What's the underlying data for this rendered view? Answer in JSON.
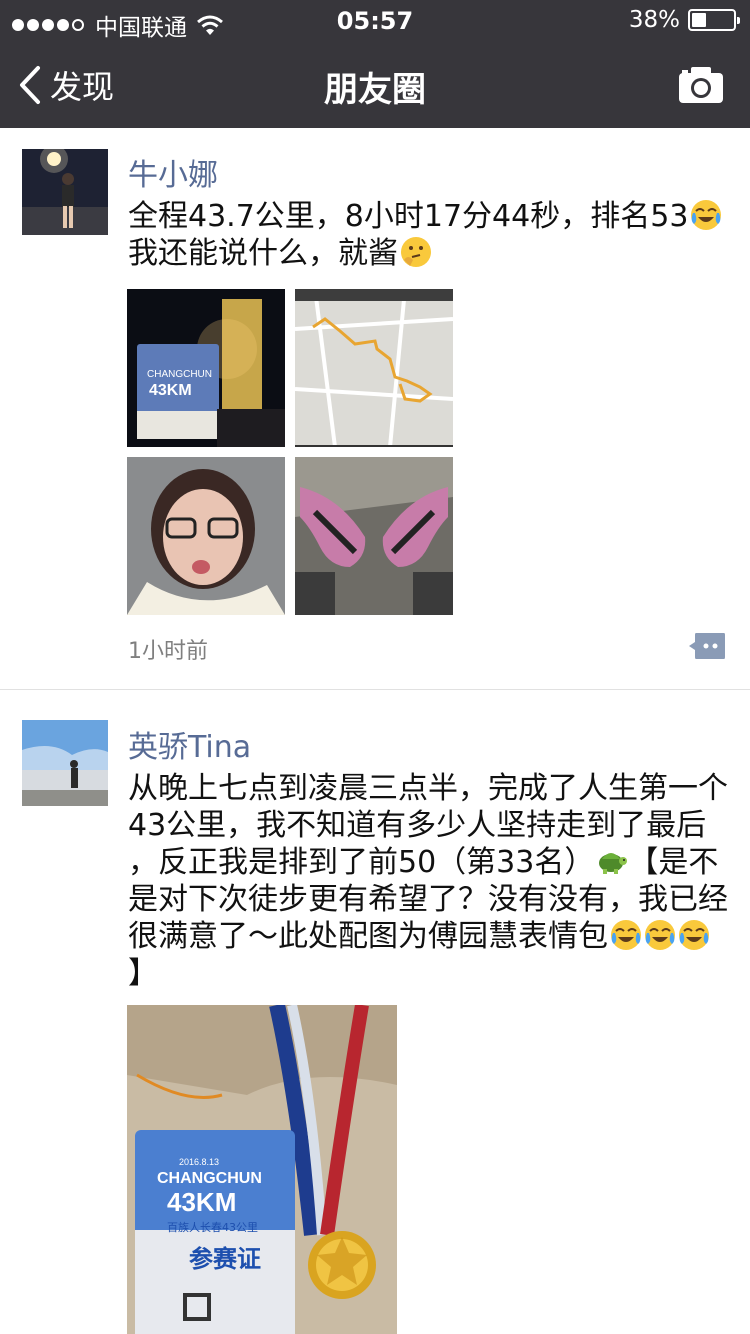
{
  "status_bar": {
    "carrier": "中国联通",
    "time": "05:57",
    "battery": "38%"
  },
  "nav": {
    "back_label": "发现",
    "title": "朋友圈"
  },
  "posts": [
    {
      "author": "牛小娜",
      "text_line1": "全程43.7公里，8小时17分44秒，排名53",
      "text_line2": "我还能说什么，就酱",
      "time": "1小时前",
      "images": [
        "night-race-photo",
        "route-map",
        "selfie",
        "running-shoes"
      ]
    },
    {
      "author": "英骄Tina",
      "text_line1": "从晚上七点到凌晨三点半，完成了人生第一个",
      "text_line2": "43公里，我不知道有多少人坚持走到了最后",
      "text_line3": "，反正我是排到了前50（第33名）",
      "text_line3b": "【是不",
      "text_line4": "是对下次徒步更有希望了？没有没有，我已经",
      "text_line5": "很满意了～此处配图为傅园慧表情包",
      "text_line6": "】",
      "card": {
        "date": "2016.8.13",
        "event": "CHANGCHUN",
        "distance": "43KM",
        "subtitle": "百族人长春43公里",
        "badge": "参赛证"
      }
    }
  ],
  "colors": {
    "nav_bg": "#37363b",
    "name": "#576b95",
    "time": "#7f7f7f"
  }
}
